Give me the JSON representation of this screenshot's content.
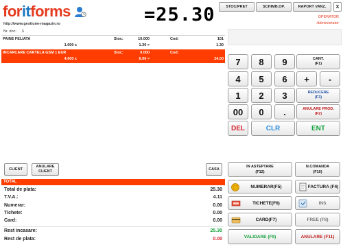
{
  "header": {
    "logo_for": "for",
    "logo_it": "it",
    "logo_forms": "forms",
    "site_url": "http://www.gestiune-magazin.ro",
    "doc_label": "Nr. doc:",
    "doc_value": "1",
    "display_total": "=25.30",
    "buttons": [
      "STOC/PRET",
      "SCHIMB.OP.",
      "RAPORT VANZ."
    ],
    "close_label": "X",
    "operator_label": "OPERATOR",
    "operator_role": "Administrator"
  },
  "items": [
    {
      "name": "PAINE FELIATA",
      "stoc_label": "Stoc:",
      "stoc": "10.000",
      "cod_label": "Cod:",
      "cod": "101",
      "qty": "1.000 x",
      "price": "1.30 =",
      "total": "1.30",
      "selected": false
    },
    {
      "name": "INCARCARE CARTELA GSM 1 EUR",
      "stoc_label": "Stoc:",
      "stoc": "0.000",
      "cod_label": "Cod:",
      "cod": "",
      "qty": "4.000 x",
      "price": "6.00 =",
      "total": "24.00",
      "selected": true
    }
  ],
  "keypad": {
    "digits": [
      "7",
      "8",
      "9",
      "4",
      "5",
      "6",
      "1",
      "2",
      "3",
      "00",
      "0",
      "."
    ],
    "plus": "+",
    "minus": "-",
    "cant_line1": "CANT.",
    "cant_line2": "(F1)",
    "reducere_line1": "REDUCERE",
    "reducere_line2": "(F3)",
    "anulare_prod_line1": "ANULARE PROD.",
    "anulare_prod_line2": "(F2)",
    "del": "DEL",
    "clr": "CLR",
    "ent": "ENT"
  },
  "client_bar": {
    "client": "CLIENT",
    "anulare_client_line1": "ANULARE",
    "anulare_client_line2": "CLIENT",
    "casa": "CASA"
  },
  "summary": {
    "total_heading": "TOTAL",
    "rows": [
      {
        "label": "Total de plata:",
        "value": "25.30"
      },
      {
        "label": "T.V.A.:",
        "value": "4.11"
      },
      {
        "label": "Numerar:",
        "value": "0.00"
      },
      {
        "label": "Tichete:",
        "value": "0.00"
      },
      {
        "label": "Card:",
        "value": "0.00"
      }
    ],
    "rest_incasare_label": "Rest incasare:",
    "rest_incasare_value": "25.30",
    "rest_plata_label": "Rest de plata:",
    "rest_plata_value": "0.00"
  },
  "payment": {
    "in_asteptare_line1": "IN ASTEPTARE",
    "in_asteptare_line2": "(F12)",
    "ncomanda_line1": "N.COMANDA",
    "ncomanda_line2": "(F10)",
    "numerar": "NUMERAR(F5)",
    "factura": "FACTURA (F4)",
    "tichete": "TICHETE(F6)",
    "ins": "INS",
    "card": "CARD(F7)",
    "free": "FREE (F8)",
    "validare": "VALIDARE (F9)",
    "anulare": "ANULARE (F11)"
  },
  "colors": {
    "brand_red": "#e53a1e",
    "brand_blue": "#1b76c0",
    "selection": "#ff3d00",
    "green": "#12a03a",
    "red": "#d4202c"
  },
  "icons": [
    "user-avatar-icon",
    "coins-icon",
    "invoice-icon",
    "ticket-icon",
    "ins-icon",
    "credit-card-icon"
  ]
}
